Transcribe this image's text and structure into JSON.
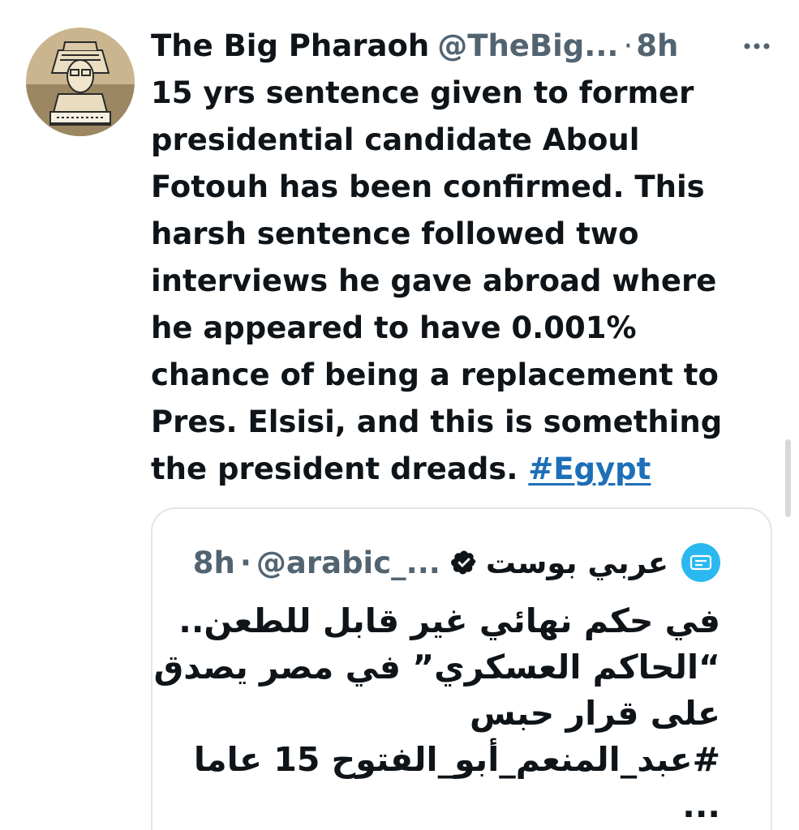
{
  "tweet": {
    "author_name": "The Big Pharaoh",
    "author_handle": "@TheBig...",
    "separator": "·",
    "time": "8h",
    "more_icon": "more-horizontal-icon",
    "text_lines": [
      "15 yrs sentence given to former",
      "presidential candidate Aboul",
      "Fotouh has been confirmed. This",
      "harsh sentence followed two",
      "interviews he gave abroad where",
      "he appeared to have 0.001%",
      "chance of being a replacement to",
      "Pres. Elsisi, and this is something",
      "the president dreads."
    ],
    "hashtag": "#Egypt"
  },
  "quoted_tweet": {
    "author_name": "عربي بوست",
    "author_handle": "@arabic_...",
    "separator": "·",
    "time": "8h",
    "verified_icon": "verified-badge-icon",
    "text_lines": [
      "في حكم نهائي غير قابل للطعن..",
      "“الحاكم العسكري” في مصر يصدق",
      "على قرار حبس",
      "#عبد_المنعم_أبو_الفتوح 15 عاما",
      "..."
    ]
  },
  "colors": {
    "text": "#0f1419",
    "secondary": "#536471",
    "link": "#1d6fb8",
    "verified": "#0f1419",
    "quote_avatar": "#2ab8f0",
    "border": "#e1e6ea"
  }
}
